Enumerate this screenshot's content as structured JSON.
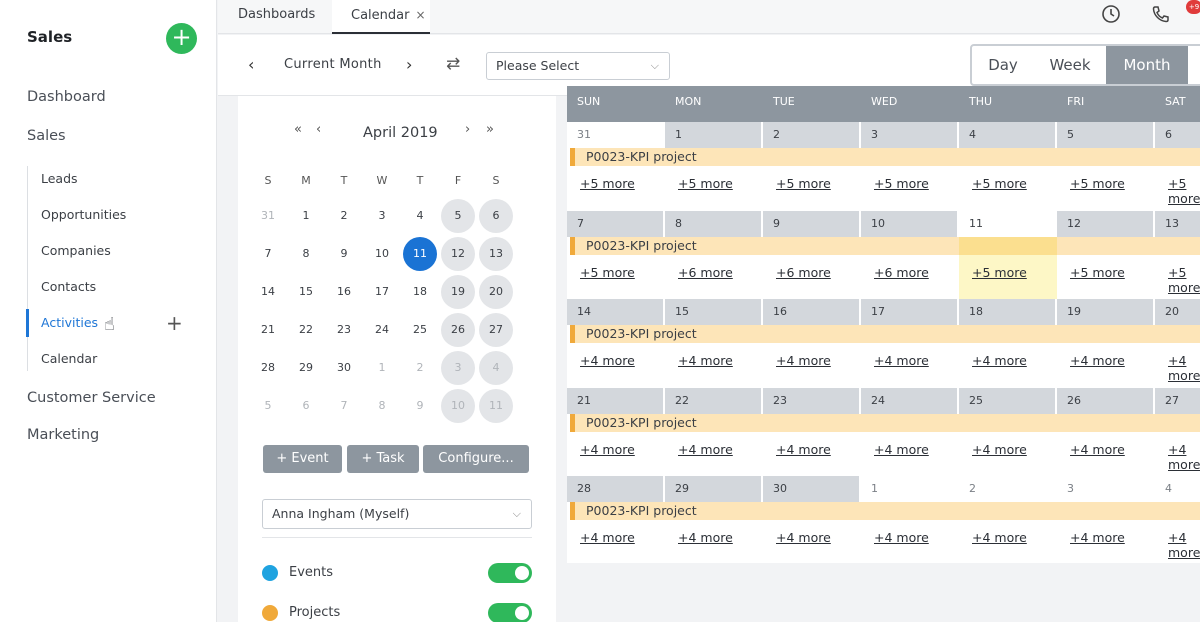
{
  "sidebar": {
    "title": "Sales",
    "add_icon": "plus-icon",
    "items": [
      {
        "label": "Dashboard"
      },
      {
        "label": "Sales"
      }
    ],
    "subitems": [
      {
        "label": "Leads"
      },
      {
        "label": "Opportunities"
      },
      {
        "label": "Companies"
      },
      {
        "label": "Contacts"
      },
      {
        "label": "Activities",
        "active": true
      },
      {
        "label": "Calendar"
      }
    ],
    "bottom_items": [
      {
        "label": "Customer Service"
      },
      {
        "label": "Marketing"
      }
    ]
  },
  "tabs": [
    {
      "label": "Dashboards"
    },
    {
      "label": "Calendar",
      "active": true,
      "close": "×"
    }
  ],
  "top_icons": [
    "clock-icon",
    "phone-icon"
  ],
  "notification_badge": "+9",
  "toolbar": {
    "current_label": "Current Month",
    "select_placeholder": "Please Select",
    "views": [
      "Day",
      "Week",
      "Month"
    ],
    "active_view": "Month"
  },
  "mini_calendar": {
    "title": "April 2019",
    "weekday_headers": [
      "S",
      "M",
      "T",
      "W",
      "T",
      "F",
      "S"
    ],
    "weeks": [
      [
        "31",
        "1",
        "2",
        "3",
        "4",
        "5",
        "6"
      ],
      [
        "7",
        "8",
        "9",
        "10",
        "11",
        "12",
        "13"
      ],
      [
        "14",
        "15",
        "16",
        "17",
        "18",
        "19",
        "20"
      ],
      [
        "21",
        "22",
        "23",
        "24",
        "25",
        "26",
        "27"
      ],
      [
        "28",
        "29",
        "30",
        "1",
        "2",
        "3",
        "4"
      ],
      [
        "5",
        "6",
        "7",
        "8",
        "9",
        "10",
        "11"
      ]
    ],
    "today": "11",
    "buttons": [
      "+ Event",
      "+ Task",
      "Configure..."
    ]
  },
  "user_select": "Anna Ingham (Myself)",
  "legend": [
    {
      "label": "Events",
      "color": "#1fa3e0"
    },
    {
      "label": "Projects",
      "color": "#f0a93a"
    }
  ],
  "calendar": {
    "dow": [
      "SUN",
      "MON",
      "TUE",
      "WED",
      "THU",
      "FRI",
      "SAT"
    ],
    "event_label": "P0023-KPI project",
    "weeks": [
      {
        "dates": [
          "31",
          "1",
          "2",
          "3",
          "4",
          "5",
          "6"
        ],
        "more": [
          "+5 more",
          "+5 more",
          "+5 more",
          "+5 more",
          "+5 more",
          "+5 more",
          "+5 more"
        ]
      },
      {
        "dates": [
          "7",
          "8",
          "9",
          "10",
          "11",
          "12",
          "13"
        ],
        "more": [
          "+5 more",
          "+6 more",
          "+6 more",
          "+6 more",
          "+5 more",
          "+5 more",
          "+5 more"
        ]
      },
      {
        "dates": [
          "14",
          "15",
          "16",
          "17",
          "18",
          "19",
          "20"
        ],
        "more": [
          "+4 more",
          "+4 more",
          "+4 more",
          "+4 more",
          "+4 more",
          "+4 more",
          "+4 more"
        ]
      },
      {
        "dates": [
          "21",
          "22",
          "23",
          "24",
          "25",
          "26",
          "27"
        ],
        "more": [
          "+4 more",
          "+4 more",
          "+4 more",
          "+4 more",
          "+4 more",
          "+4 more",
          "+4 more"
        ]
      },
      {
        "dates": [
          "28",
          "29",
          "30",
          "1",
          "2",
          "3",
          "4"
        ],
        "more": [
          "+4 more",
          "+4 more",
          "+4 more",
          "+4 more",
          "+4 more",
          "+4 more",
          "+4 more"
        ]
      }
    ]
  }
}
